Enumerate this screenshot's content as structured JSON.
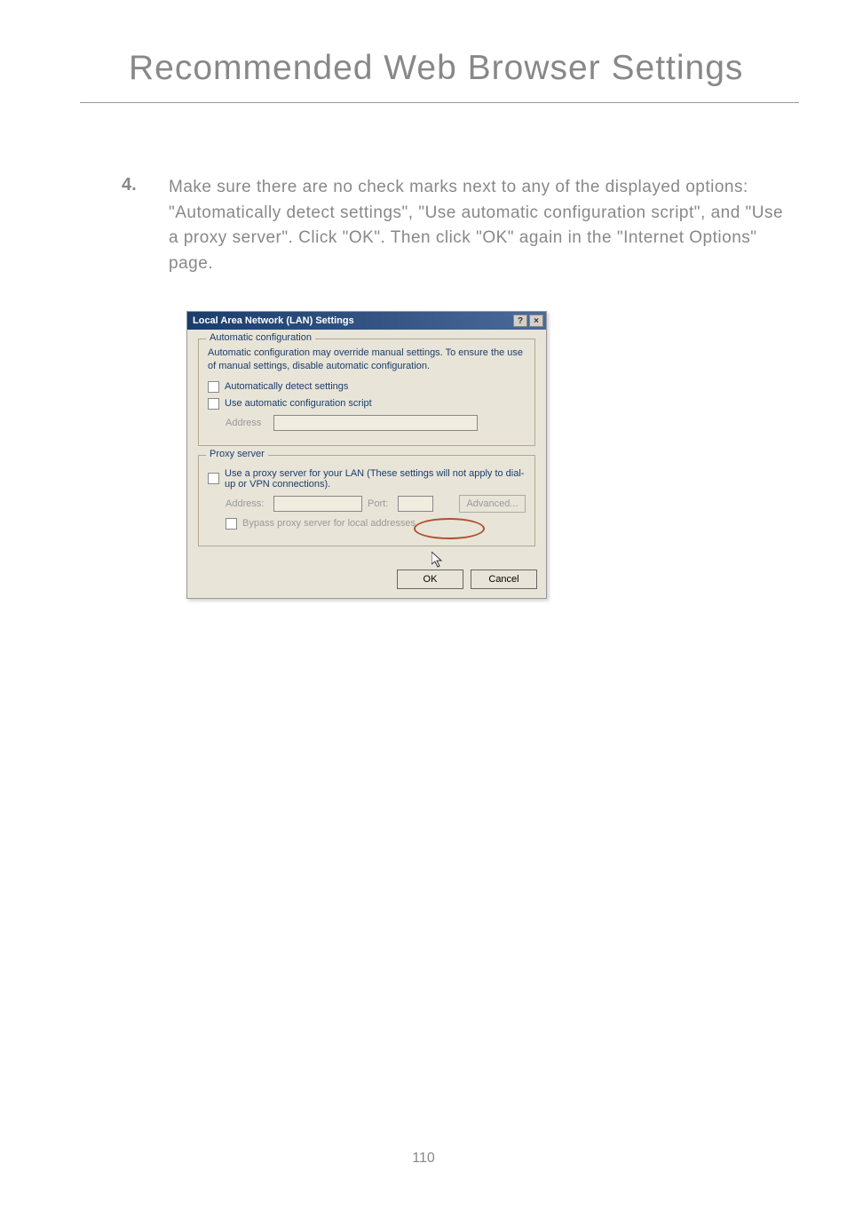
{
  "page_title": "Recommended Web Browser Settings",
  "step": {
    "number": "4.",
    "text": "Make sure there are no check marks next to any of the displayed options: \"Automatically detect settings\", \"Use automatic configuration script\", and \"Use a proxy server\". Click \"OK\". Then click \"OK\" again in the \"Internet Options\" page."
  },
  "dialog": {
    "title": "Local Area Network (LAN) Settings",
    "help_btn": "?",
    "close_btn": "×",
    "auto_config": {
      "legend": "Automatic configuration",
      "desc": "Automatic configuration may override manual settings. To ensure the use of manual settings, disable automatic configuration.",
      "detect_label": "Automatically detect settings",
      "script_label": "Use automatic configuration script",
      "address_label": "Address"
    },
    "proxy": {
      "legend": "Proxy server",
      "use_label": "Use a proxy server for your LAN (These settings will not apply to dial-up or VPN connections).",
      "address_label": "Address:",
      "port_label": "Port:",
      "advanced_label": "Advanced...",
      "bypass_label": "Bypass proxy server for local addresses"
    },
    "ok_label": "OK",
    "cancel_label": "Cancel"
  },
  "page_number": "110"
}
